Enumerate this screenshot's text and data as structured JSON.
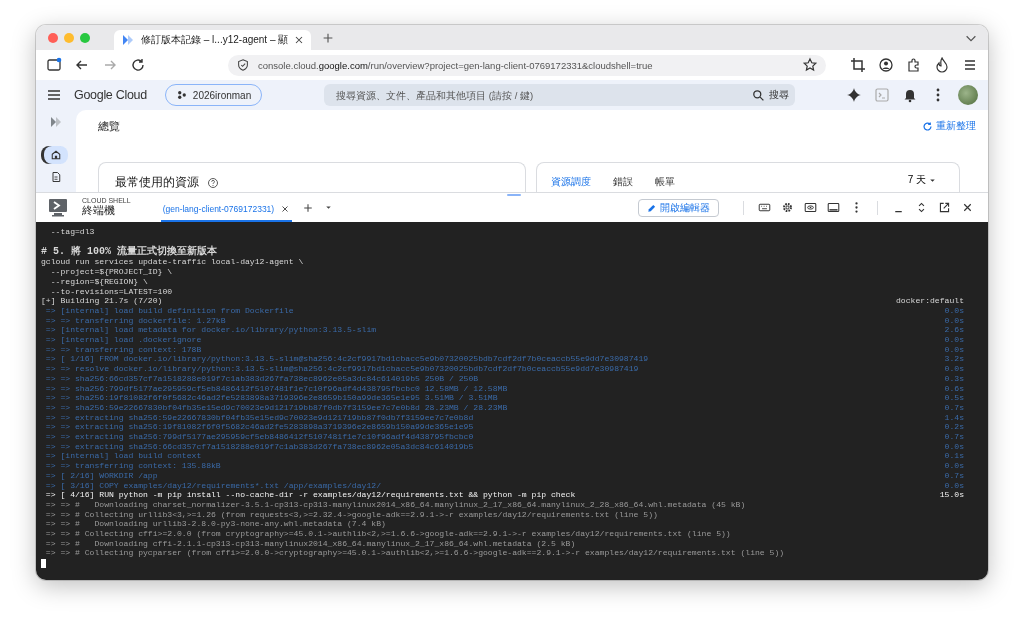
{
  "browser": {
    "tab": {
      "title": "修訂版本記錄 – l...y12-agent – 顯",
      "selected": true
    },
    "url": {
      "host": "console.cloud.google.com",
      "path": "/run/overview?project=gen-lang-client-0769172331&cloudshell=true"
    }
  },
  "console_header": {
    "product": "Google Cloud",
    "project": "2026ironman",
    "search": {
      "placeholder": "搜尋資源、文件、產品和其他項目 (請按 / 鍵)",
      "button": "搜尋"
    }
  },
  "sidebar": {
    "items": [
      {
        "kind": "home",
        "selected": true
      },
      {
        "kind": "document",
        "selected": false
      }
    ]
  },
  "page": {
    "title": "總覽",
    "refresh": "重新整理",
    "card_left": {
      "title": "最常使用的資源"
    },
    "card_right": {
      "tabs": [
        {
          "label": "資源調度",
          "selected": true
        },
        {
          "label": "錯誤",
          "selected": false
        },
        {
          "label": "帳單",
          "selected": false
        }
      ],
      "range": "7 天"
    }
  },
  "cloud_shell": {
    "label": "CLOUD SHELL",
    "title": "終端機",
    "tabs": [
      {
        "label": "(gen-lang-client-0769172331)",
        "selected": true
      }
    ],
    "editor_button": "開啟編輯器"
  },
  "terminal": {
    "lines": [
      {
        "kind": "plain",
        "text": "  --tag=dl3"
      },
      {
        "kind": "blank"
      },
      {
        "kind": "plain",
        "text": "# 5. 將 100% 流量正式切換至新版本"
      },
      {
        "kind": "plain",
        "text": "gcloud run services update-traffic local-day12-agent \\"
      },
      {
        "kind": "plain",
        "text": "  --project=${PROJECT_ID} \\"
      },
      {
        "kind": "plain",
        "text": "  --region=${REGION} \\"
      },
      {
        "kind": "plain",
        "text": "  --to-revisions=LATEST=100"
      },
      {
        "kind": "plain",
        "text": "[+] Building 21.7s (7/20)",
        "time": "docker:default"
      },
      {
        "kind": "step",
        "text": " => [internal] load build definition from Dockerfile",
        "time": "0.0s"
      },
      {
        "kind": "step",
        "text": " => => transferring dockerfile: 1.27kB",
        "time": "0.0s"
      },
      {
        "kind": "step",
        "text": " => [internal] load metadata for docker.io/library/python:3.13.5-slim",
        "time": "2.6s"
      },
      {
        "kind": "step",
        "text": " => [internal] load .dockerignore",
        "time": "0.0s"
      },
      {
        "kind": "step",
        "text": " => => transferring context: 178B",
        "time": "0.0s"
      },
      {
        "kind": "step",
        "text": " => [ 1/16] FROM docker.io/library/python:3.13.5-slim@sha256:4c2cf9917bd1cbacc5e9b07320025bdb7cdf2df7b0ceaccb55e9dd7e30987419",
        "time": "3.2s"
      },
      {
        "kind": "step",
        "text": " => => resolve docker.io/library/python:3.13.5-slim@sha256:4c2cf9917bd1cbacc5e9b07320025bdb7cdf2df7b0ceaccb55e9dd7e30987419",
        "time": "0.0s"
      },
      {
        "kind": "step",
        "text": " => => sha256:66cd357cf7a1518288e019f7c1ab383d267fa738ec8962e05a3dc84c614019b5 250B / 250B",
        "time": "0.3s"
      },
      {
        "kind": "step",
        "text": " => => sha256:799df5177ae295959cf5eb8486412f5107481f1e7c10f96adf4d438795fbcbc0 12.58MB / 12.58MB",
        "time": "0.6s"
      },
      {
        "kind": "step",
        "text": " => => sha256:19f81082f6f0f5682c46ad2fe5283898a3719396e2e8659b150a99de365e1e95 3.51MB / 3.51MB",
        "time": "0.5s"
      },
      {
        "kind": "step",
        "text": " => => sha256:59e22667830bf04fb35e15ed9c70023e9d121719bb87f0db7f3159ee7c7e0b8d 28.23MB / 28.23MB",
        "time": "0.7s"
      },
      {
        "kind": "step",
        "text": " => => extracting sha256:59e22667830bf04fb35e15ed9c70023e9d121719bb87f0db7f3159ee7c7e0b8d",
        "time": "1.4s"
      },
      {
        "kind": "step",
        "text": " => => extracting sha256:19f81082f6f0f5682c46ad2fe5283898a3719396e2e8659b150a99de365e1e95",
        "time": "0.2s"
      },
      {
        "kind": "step",
        "text": " => => extracting sha256:799df5177ae295959cf5eb8486412f5107481f1e7c10f96adf4d438795fbcbc0",
        "time": "0.7s"
      },
      {
        "kind": "step",
        "text": " => => extracting sha256:66cd357cf7a1518288e019f7c1ab383d267fa738ec8962e05a3dc84c614019b5",
        "time": "0.0s"
      },
      {
        "kind": "step",
        "text": " => [internal] load build context",
        "time": "0.1s"
      },
      {
        "kind": "step",
        "text": " => => transferring context: 135.88kB",
        "time": "0.0s"
      },
      {
        "kind": "step",
        "text": " => [ 2/16] WORKDIR /app",
        "time": "0.7s"
      },
      {
        "kind": "step",
        "text": " => [ 3/16] COPY examples/day12/requirements*.txt /app/examples/day12/",
        "time": "0.0s"
      },
      {
        "kind": "active",
        "text": " => [ 4/16] RUN python -m pip install --no-cache-dir -r examples/day12/requirements.txt && python -m pip check",
        "time": "15.0s"
      },
      {
        "kind": "log",
        "text": " => => #   Downloading charset_normalizer-3.5.1-cp313-cp313-manylinux2014_x86_64.manylinux_2_17_x86_64.manylinux_2_28_x86_64.whl.metadata (45 kB)"
      },
      {
        "kind": "log",
        "text": " => => # Collecting urllib3<3,>=1.26 (from requests<3,>=2.32.4->google-adk==2.9.1->-r examples/day12/requirements.txt (line 5))"
      },
      {
        "kind": "log",
        "text": " => => #   Downloading urllib3-2.8.0-py3-none-any.whl.metadata (7.4 kB)"
      },
      {
        "kind": "log",
        "text": " => => # Collecting cffi>=2.0.0 (from cryptography>=45.0.1->authlib<2,>=1.6.6->google-adk==2.9.1->-r examples/day12/requirements.txt (line 5))"
      },
      {
        "kind": "log",
        "text": " => => #   Downloading cffi-2.1.1-cp313-cp313-manylinux2014_x86_64.manylinux_2_17_x86_64.whl.metadata (2.5 kB)"
      },
      {
        "kind": "log",
        "text": " => => # Collecting pycparser (from cffi>=2.0.0->cryptography>=45.0.1->authlib<2,>=1.6.6->google-adk==2.9.1->-r examples/day12/requirements.txt (line 5))"
      }
    ]
  }
}
